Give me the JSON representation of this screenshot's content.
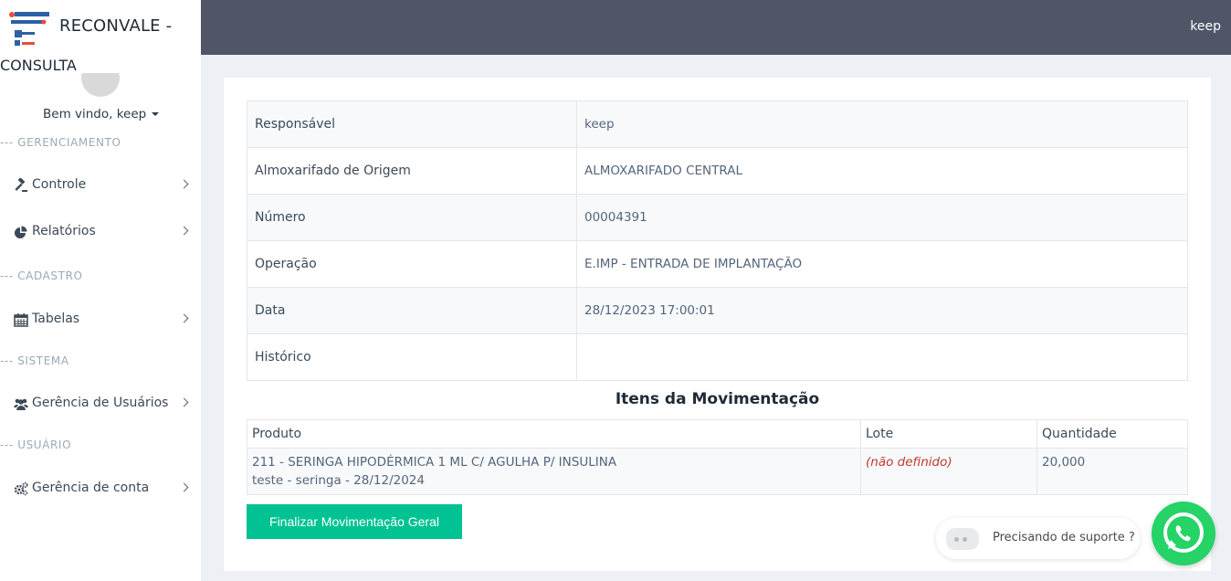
{
  "brand": {
    "title": "RECONVALE -",
    "subtitle": "CONSULTA",
    "logo_icon": "reconvale-logo"
  },
  "user": {
    "welcome": "Bem vindo, keep",
    "top_name": "keep"
  },
  "sidebar": {
    "sections": [
      "--- GERENCIAMENTO",
      "--- CADASTRO",
      "--- SISTEMA",
      "--- USUÁRIO"
    ],
    "items": [
      {
        "label": "Controle",
        "icon": "gavel-icon"
      },
      {
        "label": "Relatórios",
        "icon": "pie-chart-icon"
      },
      {
        "label": "Tabelas",
        "icon": "calendar-icon"
      },
      {
        "label": "Gerência de Usuários",
        "icon": "users-icon"
      },
      {
        "label": "Gerência de conta",
        "icon": "cogs-icon"
      }
    ]
  },
  "details": [
    {
      "label": "Responsável",
      "value": "keep"
    },
    {
      "label": "Almoxarifado de Origem",
      "value": "ALMOXARIFADO CENTRAL"
    },
    {
      "label": "Número",
      "value": "00004391"
    },
    {
      "label": "Operação",
      "value": "E.IMP - ENTRADA DE IMPLANTAÇÃO"
    },
    {
      "label": "Data",
      "value": "28/12/2023 17:00:01"
    },
    {
      "label": "Histórico",
      "value": ""
    }
  ],
  "items": {
    "title": "Itens da Movimentação",
    "headers": [
      "Produto",
      "Lote",
      "Quantidade"
    ],
    "rows": [
      {
        "produto_line1": "211 - SERINGA HIPODÉRMICA 1 ML C/ AGULHA P/ INSULINA",
        "produto_line2": "teste - seringa - 28/12/2024",
        "lote": "(não definido)",
        "quantidade": "20,000"
      }
    ]
  },
  "actions": {
    "finalize_label": "Finalizar Movimentação Geral"
  },
  "support": {
    "label": "Precisando de suporte ?",
    "whatsapp_icon": "whatsapp-icon"
  },
  "colors": {
    "topbar": "#505668",
    "accent": "#00c292",
    "whatsapp": "#25d366",
    "undefined_text": "#c0392b"
  }
}
